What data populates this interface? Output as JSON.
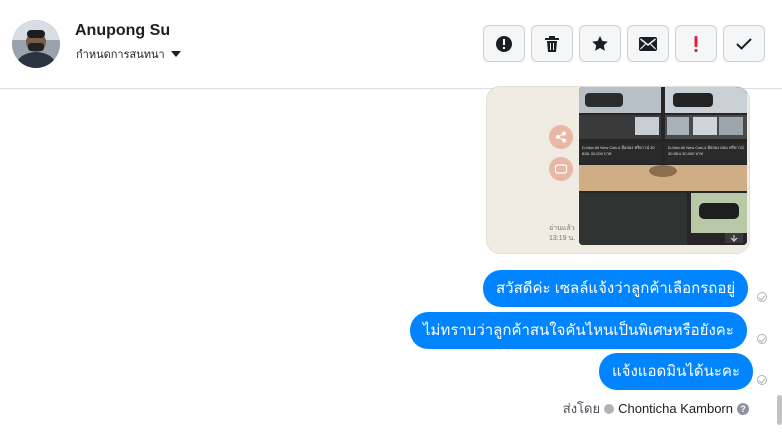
{
  "header": {
    "contact_name": "Anupong Su",
    "assign_label": "กำหนดการสนทนา",
    "actions": [
      {
        "name": "mark-spam-button",
        "icon": "alert-circle-icon"
      },
      {
        "name": "delete-button",
        "icon": "trash-icon"
      },
      {
        "name": "star-button",
        "icon": "star-icon"
      },
      {
        "name": "mark-unread-button",
        "icon": "envelope-icon"
      },
      {
        "name": "follow-up-button",
        "icon": "exclamation-icon"
      },
      {
        "name": "mark-done-button",
        "icon": "check-icon"
      }
    ]
  },
  "media": {
    "listing_left": "D-Max All New Cab-4 มือสอง ฟรีดาวน์ 30 ผ่อน 30,000 บาท",
    "listing_right": "D-Max All New Cab-4 มือสอง ผ่อน ฟรีดาวน์ 30 ผ่อน 30,000 บาท",
    "time_label": "อ่านแล้ว",
    "time": "13:19 น."
  },
  "messages": [
    {
      "text": "สวัสดีค่ะ เซลล์แจ้งว่าลูกค้าเลือกรถอยู่"
    },
    {
      "text": "ไม่ทราบว่าลูกค้าสนใจคันไหนเป็นพิเศษหรือยังคะ"
    },
    {
      "text": "แจ้งแอดมินได้นะคะ"
    }
  ],
  "sent_by": {
    "label": "ส่งโดย",
    "agent": "Chonticha Kamborn",
    "help": "?"
  },
  "colors": {
    "bubble": "#0084ff",
    "follow_up": "#e41e3f"
  }
}
